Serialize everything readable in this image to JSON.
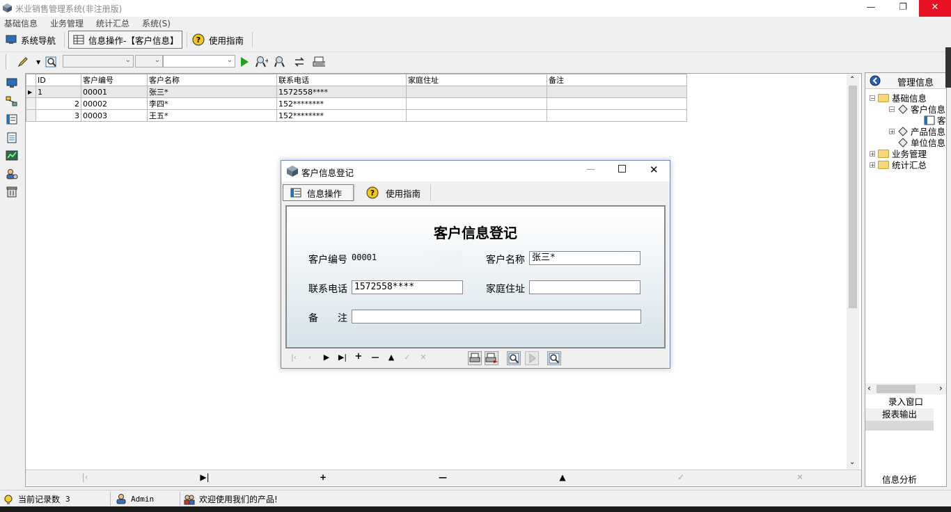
{
  "app": {
    "title": "米业销售管理系统(非注册版)"
  },
  "menu": [
    "基础信息",
    "业务管理",
    "统计汇总",
    "系统(S)"
  ],
  "nav_tabs": [
    {
      "label": "系统导航",
      "icon": "monitor-icon"
    },
    {
      "label": "信息操作-【客户信息】",
      "icon": "grid-table-icon",
      "active": true
    },
    {
      "label": "使用指南",
      "icon": "help-icon"
    }
  ],
  "grid": {
    "columns": [
      "ID",
      "客户编号",
      "客户名称",
      "联系电话",
      "家庭住址",
      "备注"
    ],
    "rows": [
      [
        "1",
        "00001",
        "张三*",
        "1572558****",
        "",
        ""
      ],
      [
        "2",
        "00002",
        "李四*",
        "152********",
        "",
        ""
      ],
      [
        "3",
        "00003",
        "王五*",
        "152********",
        "",
        ""
      ]
    ]
  },
  "right_panel": {
    "header": "管理信息",
    "tree": [
      {
        "label": "基础信息",
        "level": 0,
        "expander": "−"
      },
      {
        "label": "客户信息",
        "level": 1,
        "expander": "−"
      },
      {
        "label": "客户",
        "level": 2,
        "expander": ""
      },
      {
        "label": "产品信息",
        "level": 1,
        "expander": "+"
      },
      {
        "label": "单位信息",
        "level": 1,
        "expander": ""
      },
      {
        "label": "业务管理",
        "level": 0,
        "expander": "+"
      },
      {
        "label": "统计汇总",
        "level": 0,
        "expander": "+"
      }
    ],
    "actions": [
      "录入窗口",
      "报表输出"
    ],
    "footer": "信息分析"
  },
  "status": {
    "record_count_label": "当前记录数",
    "record_count": "3",
    "user": "Admin",
    "message": "欢迎使用我们的产品!"
  },
  "dialog": {
    "title": "客户信息登记",
    "tabs": [
      "信息操作",
      "使用指南"
    ],
    "form_title": "客户信息登记",
    "fields": {
      "customer_id_label": "客户编号",
      "customer_id": "00001",
      "customer_name_label": "客户名称",
      "customer_name": "张三*",
      "phone_label": "联系电话",
      "phone": "1572558****",
      "address_label": "家庭住址",
      "address": "",
      "remark_label": "备　　注",
      "remark": ""
    }
  }
}
